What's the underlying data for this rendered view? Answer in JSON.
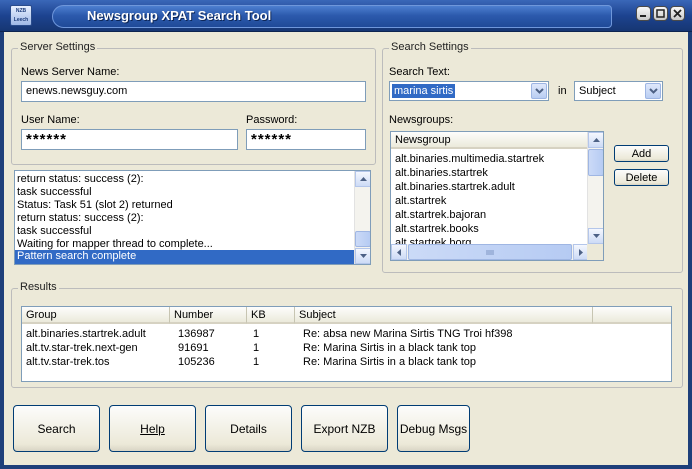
{
  "window": {
    "title": "Newsgroup XPAT Search Tool",
    "logo_text": "NZB Leech"
  },
  "server": {
    "group_title": "Server Settings",
    "server_label": "News Server Name:",
    "server_value": "enews.newsguy.com",
    "user_label": "User Name:",
    "user_value": "******",
    "password_label": "Password:",
    "password_value": "******"
  },
  "log": {
    "lines": [
      "  return status: success (2):",
      "  task successful",
      "Status: Task 51 (slot 2) returned",
      "  return status: success (2):",
      "  task successful",
      "Waiting for mapper thread to complete...",
      "Pattern search complete"
    ],
    "selected_index": 6
  },
  "search": {
    "group_title": "Search Settings",
    "text_label": "Search Text:",
    "text_value": "marina sirtis",
    "in_label": "in",
    "field_value": "Subject",
    "newsgroups_label": "Newsgroups:",
    "newsgroups_header": "Newsgroup",
    "newsgroups": [
      "alt.binaries.multimedia.startrek",
      "alt.binaries.startrek",
      "alt.binaries.startrek.adult",
      "alt.startrek",
      "alt.startrek.bajoran",
      "alt.startrek.books",
      "alt.startrek.borg"
    ],
    "add_label": "Add",
    "delete_label": "Delete"
  },
  "results": {
    "group_title": "Results",
    "columns": [
      "Group",
      "Number",
      "KB",
      "Subject"
    ],
    "rows": [
      [
        "alt.binaries.startrek.adult",
        "136987",
        "1",
        "Re: absa new Marina Sirtis TNG Troi hf398"
      ],
      [
        "alt.tv.star-trek.next-gen",
        "91691",
        "1",
        "Re: Marina Sirtis in a black tank top"
      ],
      [
        "alt.tv.star-trek.tos",
        "105236",
        "1",
        "Re: Marina Sirtis in a black tank top"
      ]
    ]
  },
  "buttons": {
    "search": "Search",
    "help": "Help",
    "details": "Details",
    "export": "Export NZB",
    "debug": "Debug Msgs"
  },
  "colors": {
    "selection": "#316ac5",
    "titlebar": "#1d4390",
    "face": "#ece9d8"
  }
}
